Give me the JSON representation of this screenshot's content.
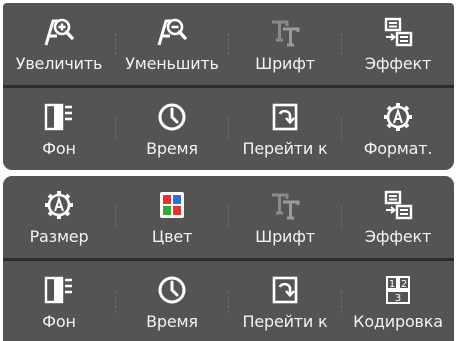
{
  "panels": [
    {
      "rows": [
        [
          {
            "label": "Увеличить",
            "icon": "zoom-in-icon"
          },
          {
            "label": "Уменьшить",
            "icon": "zoom-out-icon"
          },
          {
            "label": "Шрифт",
            "icon": "font-icon",
            "disabled": true
          },
          {
            "label": "Эффект",
            "icon": "effect-icon"
          }
        ],
        [
          {
            "label": "Фон",
            "icon": "background-icon"
          },
          {
            "label": "Время",
            "icon": "clock-icon"
          },
          {
            "label": "Перейти к",
            "icon": "goto-icon"
          },
          {
            "label": "Формат.",
            "icon": "format-gear-icon"
          }
        ]
      ]
    },
    {
      "rows": [
        [
          {
            "label": "Размер",
            "icon": "size-gear-icon"
          },
          {
            "label": "Цвет",
            "icon": "color-icon"
          },
          {
            "label": "Шрифт",
            "icon": "font-icon",
            "disabled": true
          },
          {
            "label": "Эффект",
            "icon": "effect-icon"
          }
        ],
        [
          {
            "label": "Фон",
            "icon": "background-icon"
          },
          {
            "label": "Время",
            "icon": "clock-icon"
          },
          {
            "label": "Перейти к",
            "icon": "goto-icon"
          },
          {
            "label": "Кодировка",
            "icon": "encoding-icon"
          }
        ]
      ]
    }
  ],
  "colors": {
    "panel": "#545454",
    "separator": "#2c2c2c",
    "text": "#f2f2f2",
    "icon": "#ffffff",
    "disabled_icon": "#8a8a8a",
    "color_red": "#e8322e",
    "color_blue": "#2f6fdc",
    "color_green": "#2faa3a"
  }
}
